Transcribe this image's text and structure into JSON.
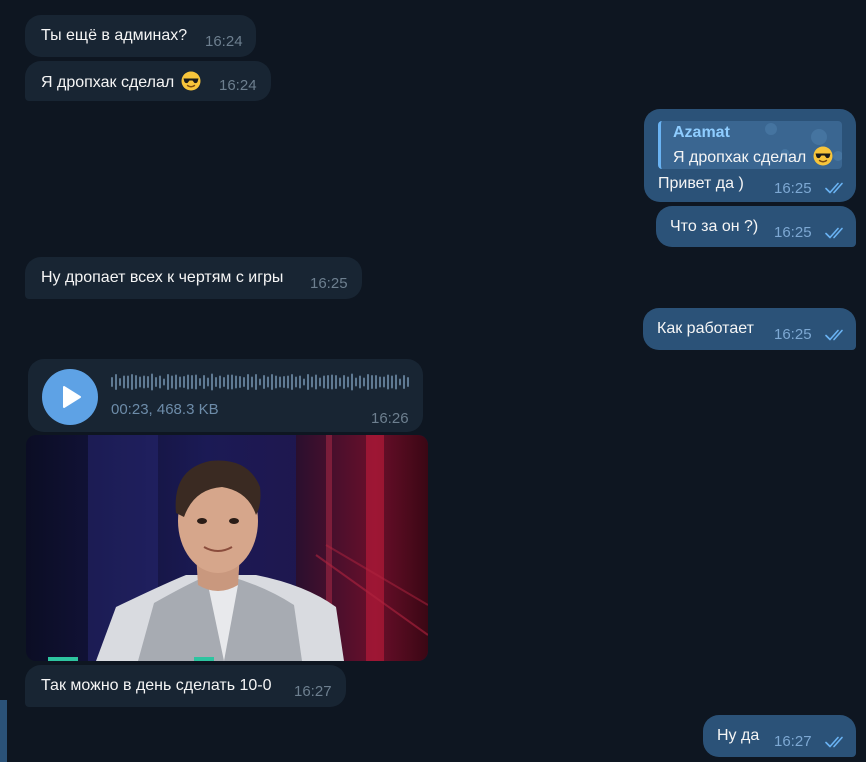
{
  "messages": {
    "m1": {
      "text": "Ты ещё в админах?",
      "time": "16:24"
    },
    "m2": {
      "text": "Я дропхак сделал",
      "time": "16:24",
      "emoji": "sunglasses-emoji"
    },
    "m3": {
      "reply_author": "Azamat",
      "reply_text": "Я дропхак сделал",
      "text": "Привет да )",
      "time": "16:25"
    },
    "m4": {
      "text": "Что за он ?)",
      "time": "16:25"
    },
    "m5": {
      "text": "Ну дропает всех к чертям с игры",
      "time": "16:25"
    },
    "m6": {
      "text": "Как работает",
      "time": "16:25"
    },
    "m7": {
      "voice_meta": "00:23, 468.3 KB",
      "time": "16:26"
    },
    "m8": {
      "text": "Так можно в день сделать 10-0",
      "time": "16:27"
    },
    "m9": {
      "text": "Ну да",
      "time": "16:27"
    }
  },
  "colors": {
    "background": "#0e1621",
    "incoming_bubble": "#182533",
    "outgoing_bubble": "#2b5278",
    "accent": "#5ea2e5",
    "read_checks": "#6ab3f3"
  },
  "icons": {
    "read_receipt": "double-check-icon",
    "play": "play-icon"
  }
}
